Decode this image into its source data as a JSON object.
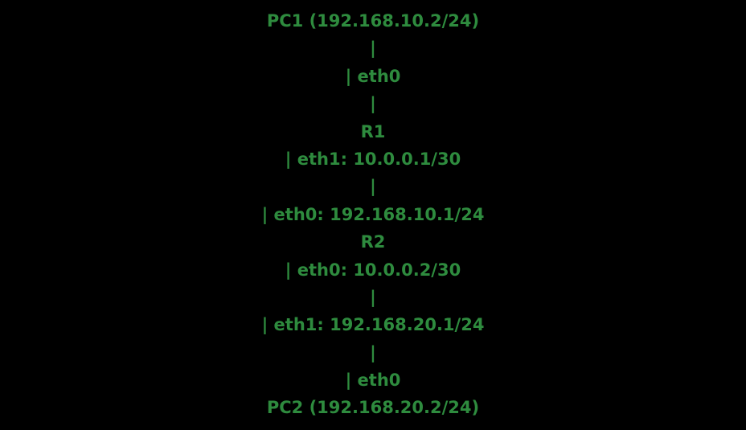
{
  "colors": {
    "background": "#000000",
    "text": "#2e8b3e"
  },
  "diagram": {
    "lines": [
      "PC1 (192.168.10.2/24)",
      "|",
      "| eth0",
      "|",
      "R1",
      "| eth1: 10.0.0.1/30",
      "|",
      "| eth0: 192.168.10.1/24",
      "R2",
      "| eth0: 10.0.0.2/30",
      "|",
      "| eth1: 192.168.20.1/24",
      "|",
      "| eth0",
      "PC2 (192.168.20.2/24)"
    ]
  }
}
